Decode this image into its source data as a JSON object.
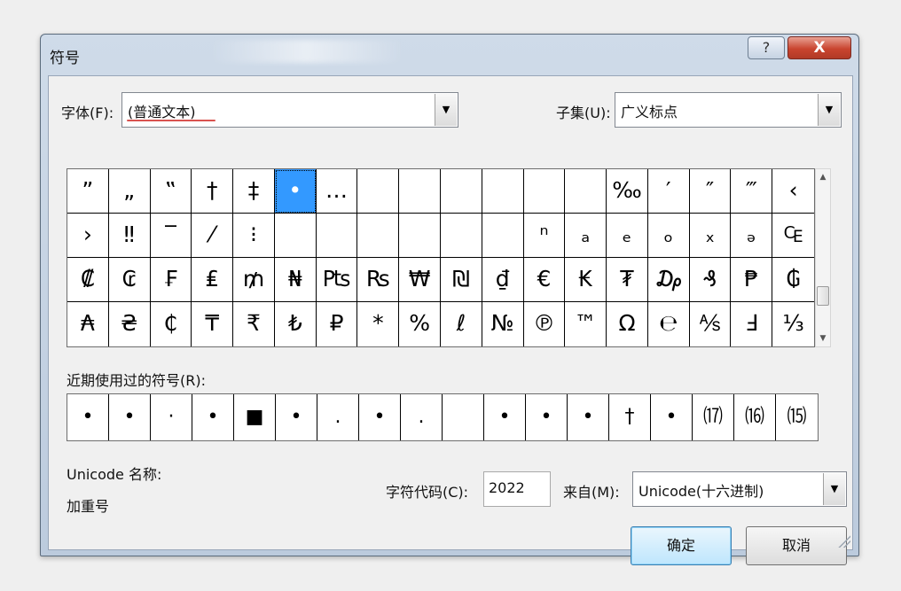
{
  "dialog": {
    "title": "符号"
  },
  "controls": {
    "help": "?",
    "close": "X"
  },
  "font": {
    "label": "字体(F):",
    "value": "(普通文本)"
  },
  "subset": {
    "label": "子集(U):",
    "value": "广义标点"
  },
  "symbols": [
    "”",
    "„",
    "‟",
    "†",
    "‡",
    "•",
    "…",
    "",
    "",
    "",
    "",
    "",
    "",
    "‰",
    "′",
    "″",
    "‴",
    "‹",
    "›",
    "‼",
    "‾",
    "⁄",
    "⁝",
    "",
    "",
    "",
    "",
    "",
    "",
    "ⁿ",
    "ₐ",
    "ₑ",
    "ₒ",
    "ₓ",
    "ₔ",
    "₠",
    "₡",
    "₢",
    "₣",
    "₤",
    "₥",
    "₦",
    "₧",
    "₨",
    "₩",
    "₪",
    "₫",
    "€",
    "₭",
    "₮",
    "₯",
    "₰",
    "₱",
    "₲",
    "₳",
    "₴",
    "₵",
    "₸",
    "₹",
    "₺",
    "₽",
    "*",
    "%",
    "ℓ",
    "№",
    "℗",
    "™",
    "Ω",
    "℮",
    "⅍",
    "Ⅎ",
    "⅓"
  ],
  "selected_index": 5,
  "recent": {
    "label": "近期使用过的符号(R):",
    "items": [
      "•",
      "•",
      "·",
      "•",
      "■",
      "•",
      ".",
      "•",
      ".",
      "",
      "•",
      "•",
      "•",
      "†",
      "•",
      "⒄",
      "⒃",
      "⒂"
    ]
  },
  "unicode_name": {
    "label": "Unicode 名称:",
    "value": "加重号"
  },
  "char_code": {
    "label": "字符代码(C):",
    "value": "2022"
  },
  "from": {
    "label": "来自(M):",
    "value": "Unicode(十六进制)"
  },
  "buttons": {
    "ok": "确定",
    "cancel": "取消"
  }
}
